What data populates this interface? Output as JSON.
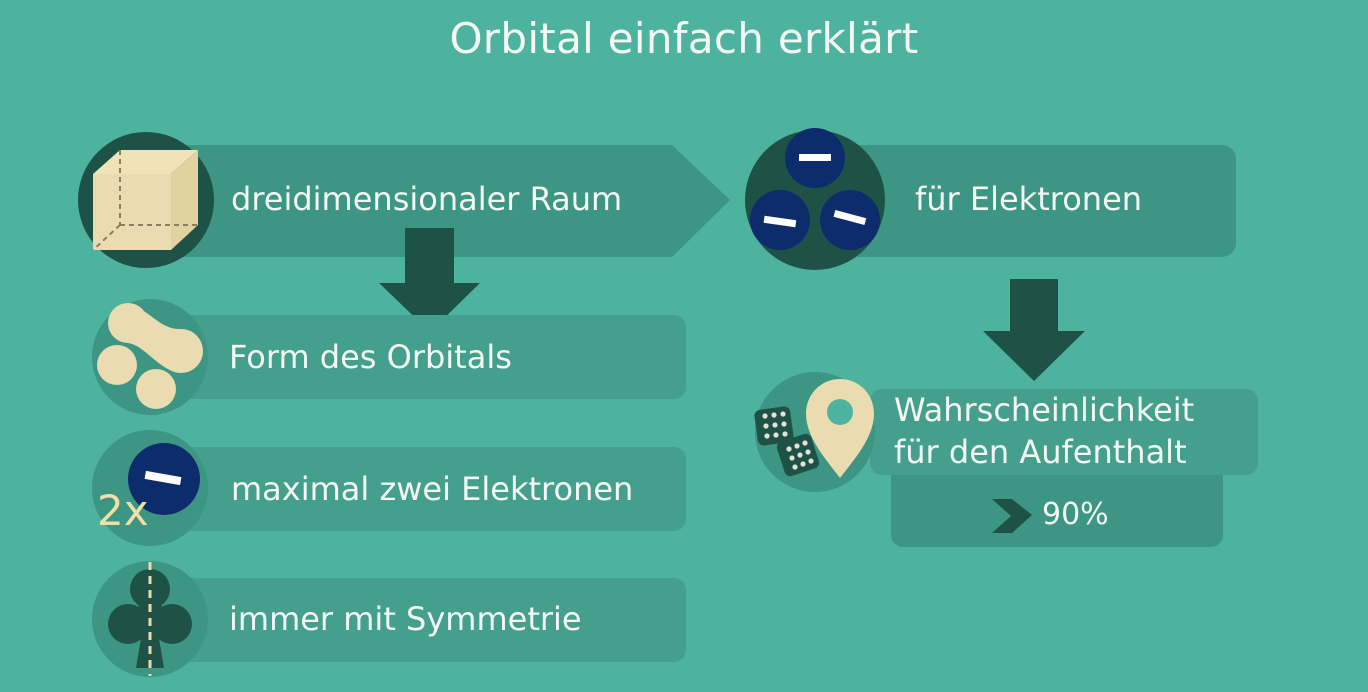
{
  "title": "Orbital einfach erklärt",
  "boxes": {
    "space": "dreidimensionaler Raum",
    "electrons": "für Elektronen",
    "shape": "Form des Orbitals",
    "max_two": "maximal zwei Elektronen",
    "symmetry": "immer mit Symmetrie",
    "probability_line1": "Wahrscheinlichkeit",
    "probability_line2": "für den Aufenthalt",
    "percent": "90%"
  },
  "icon_text": {
    "two_x": "2x"
  },
  "colors": {
    "background": "#4db29e",
    "box": "#3d9583",
    "box_light": "#44a08d",
    "dark": "#1f5247",
    "cream": "#eadcb0",
    "navy": "#0d2c6b"
  }
}
